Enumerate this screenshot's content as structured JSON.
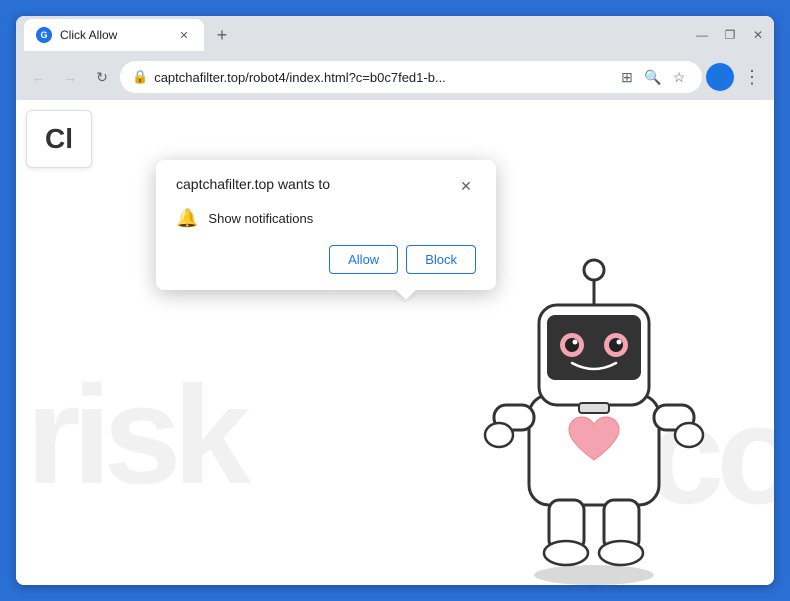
{
  "browser": {
    "tab": {
      "title": "Click Allow",
      "favicon_label": "G"
    },
    "new_tab_icon": "+",
    "window_controls": {
      "minimize": "—",
      "maximize": "❐",
      "close": "✕"
    },
    "nav": {
      "back": "←",
      "forward": "→",
      "refresh": "↻"
    },
    "url": {
      "lock_icon": "🔒",
      "text": "captchafilter.top/robot4/index.html?c=b0c7fed1-b...",
      "translate_icon": "⊞",
      "search_icon": "🔍",
      "bookmark_icon": "☆",
      "profile_icon": "👤",
      "menu_icon": "⋮"
    }
  },
  "page": {
    "partial_title": "Cl",
    "watermark_left": "risk",
    "watermark_right": "co"
  },
  "popup": {
    "title": "captchafilter.top wants to",
    "close_icon": "✕",
    "notification_text": "Show notifications",
    "allow_label": "Allow",
    "block_label": "Block"
  },
  "robot": {
    "description": "cute robot illustration"
  }
}
